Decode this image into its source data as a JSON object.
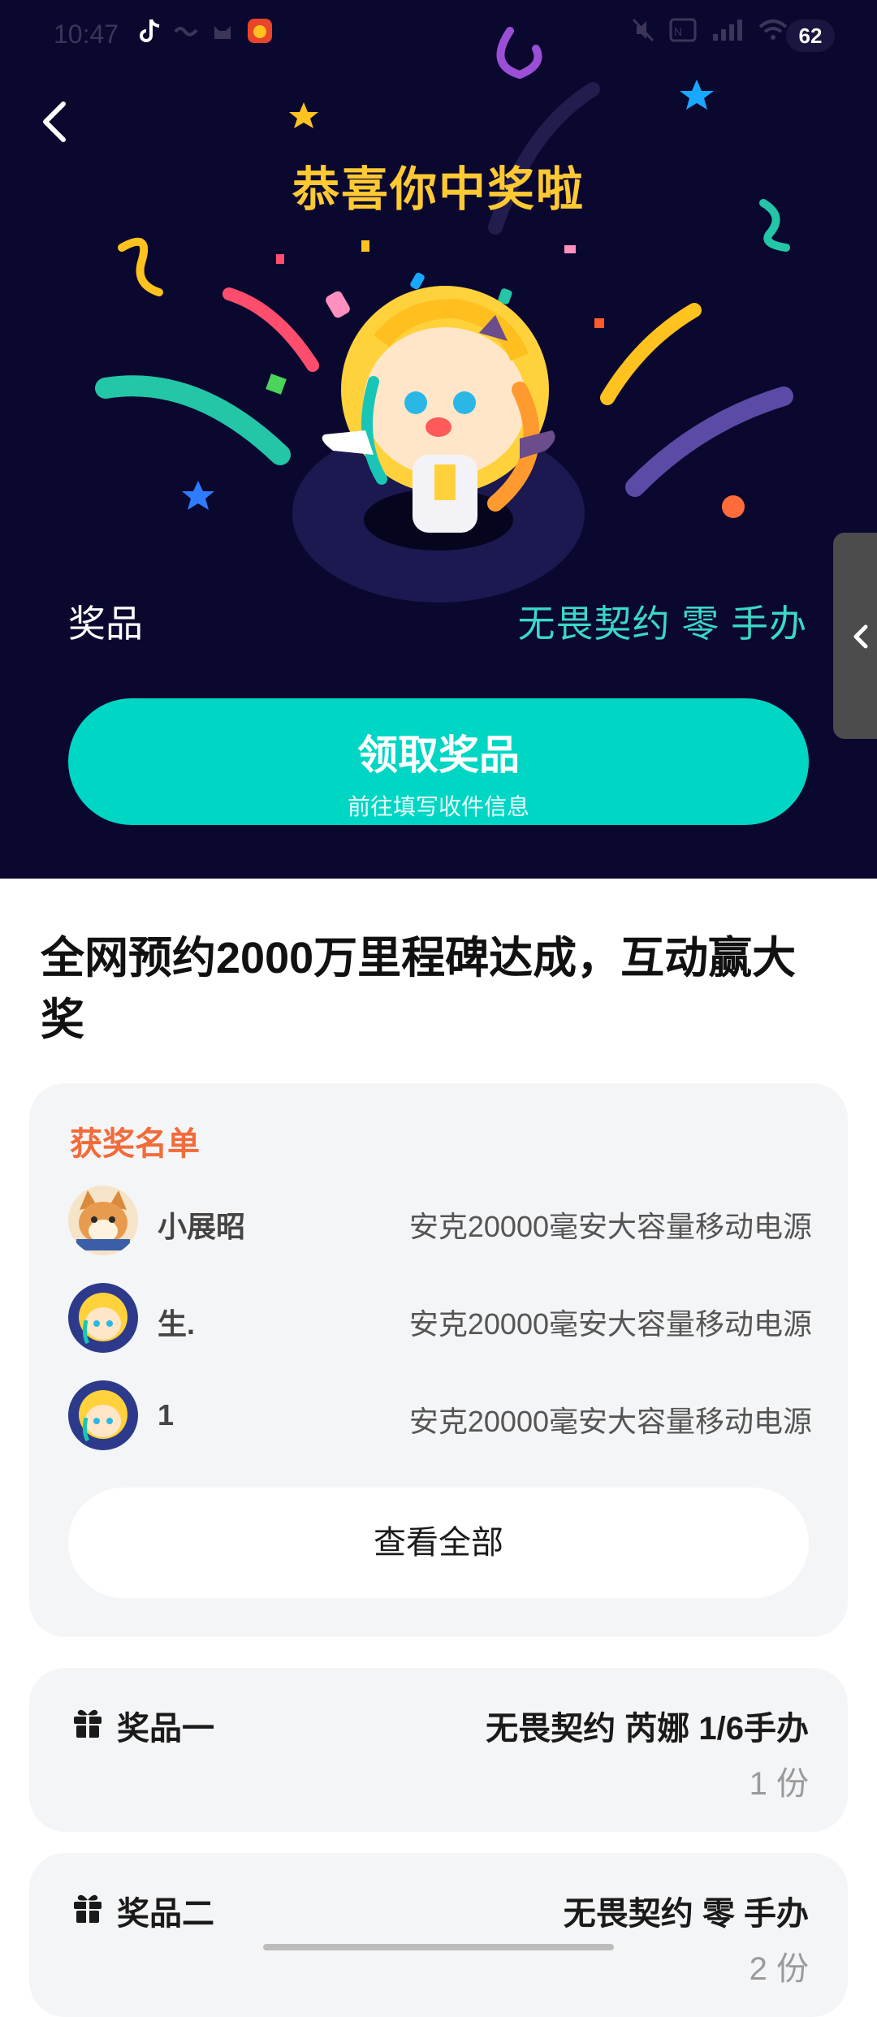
{
  "status_bar": {
    "time": "10:47",
    "battery": "62",
    "left_icons": [
      "tiktok-icon",
      "message-icon",
      "cat-icon",
      "app-icon"
    ],
    "right_icons": [
      "mute-icon",
      "nfc-icon",
      "signal-icon",
      "wifi-icon"
    ]
  },
  "hero": {
    "title": "恭喜你中奖啦",
    "prize_label": "奖品",
    "prize_name": "无畏契约 零 手办",
    "claim_button": {
      "title": "领取奖品",
      "subtitle": "前往填写收件信息"
    }
  },
  "event": {
    "title": "全网预约2000万里程碑达成，互动赢大奖"
  },
  "winners": {
    "heading": "获奖名单",
    "rows": [
      {
        "name": "小展昭",
        "prize": "安克20000毫安大容量移动电源",
        "avatar": "shiba-avatar"
      },
      {
        "name": "生.",
        "prize": "安克20000毫安大容量移动电源",
        "avatar": "anime-avatar"
      },
      {
        "name": "1",
        "prize": "安克20000毫安大容量移动电源",
        "avatar": "anime-avatar"
      }
    ],
    "view_all": "查看全部"
  },
  "prizes": [
    {
      "title": "奖品一",
      "name": "无畏契约 芮娜 1/6手办",
      "count": "1 份"
    },
    {
      "title": "奖品二",
      "name": "无畏契约 零 手办",
      "count": "2 份"
    }
  ],
  "colors": {
    "hero_bg": "#0b0830",
    "title_yellow": "#ffc933",
    "accent_teal": "#00d6c4",
    "prize_teal": "#3ad8c8",
    "winners_orange": "#f26b3a"
  }
}
